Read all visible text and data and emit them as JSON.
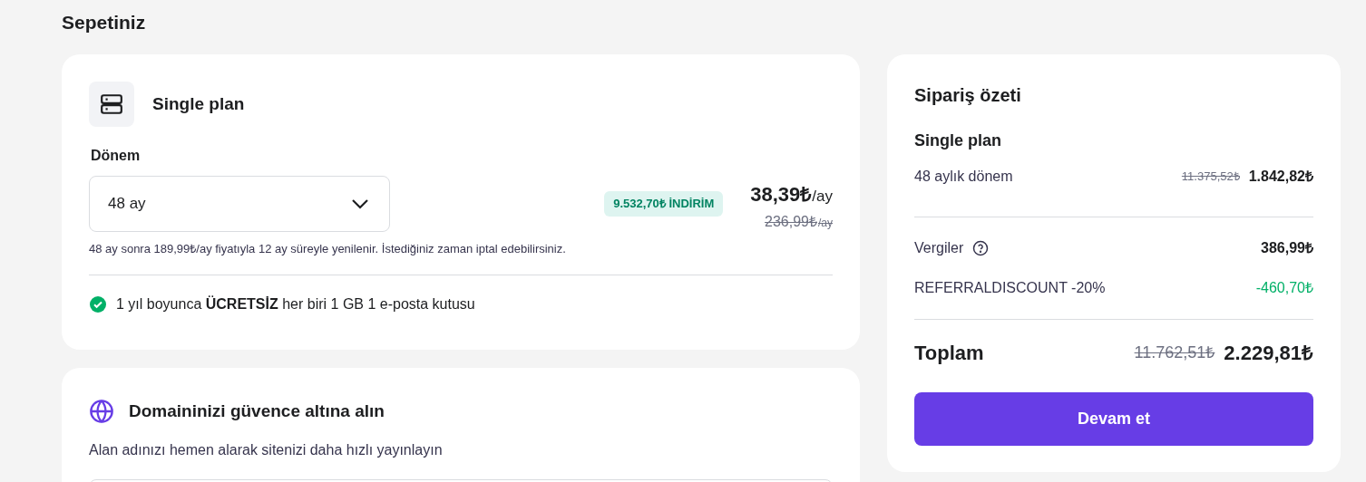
{
  "page_title": "Sepetiniz",
  "plan_card": {
    "title": "Single plan",
    "period_label": "Dönem",
    "period_value": "48 ay",
    "discount_badge": "9.532,70₺ İNDİRİM",
    "price": "38,39₺",
    "price_unit": "/ay",
    "old_price": "236,99₺",
    "old_price_unit": "/ay",
    "renewal_note": "48 ay sonra 189,99₺/ay fiyatıyla 12 ay süreyle yenilenir. İstediğiniz zaman iptal edebilirsiniz.",
    "perk": "1 yıl boyunca **ÜCRETSİZ** her biri 1 GB 1 e-posta kutusu"
  },
  "domain_card": {
    "title": "Domaininizi güvence altına alın",
    "subtitle": "Alan adınızı hemen alarak sitenizi daha hızlı yayınlayın"
  },
  "summary": {
    "title": "Sipariş özeti",
    "plan_name": "Single plan",
    "lines": [
      {
        "kind": "period",
        "label": "48 aylık dönem",
        "old_value": "11.375,52₺",
        "value": "1.842,82₺"
      },
      {
        "kind": "tax",
        "label": "Vergiler",
        "value": "386,99₺"
      },
      {
        "kind": "discount",
        "label": "REFERRALDISCOUNT -20%",
        "value": "-460,70₺"
      }
    ],
    "total_label": "Toplam",
    "total_old": "11.762,51₺",
    "total": "2.229,81₺",
    "button": "Devam et"
  }
}
